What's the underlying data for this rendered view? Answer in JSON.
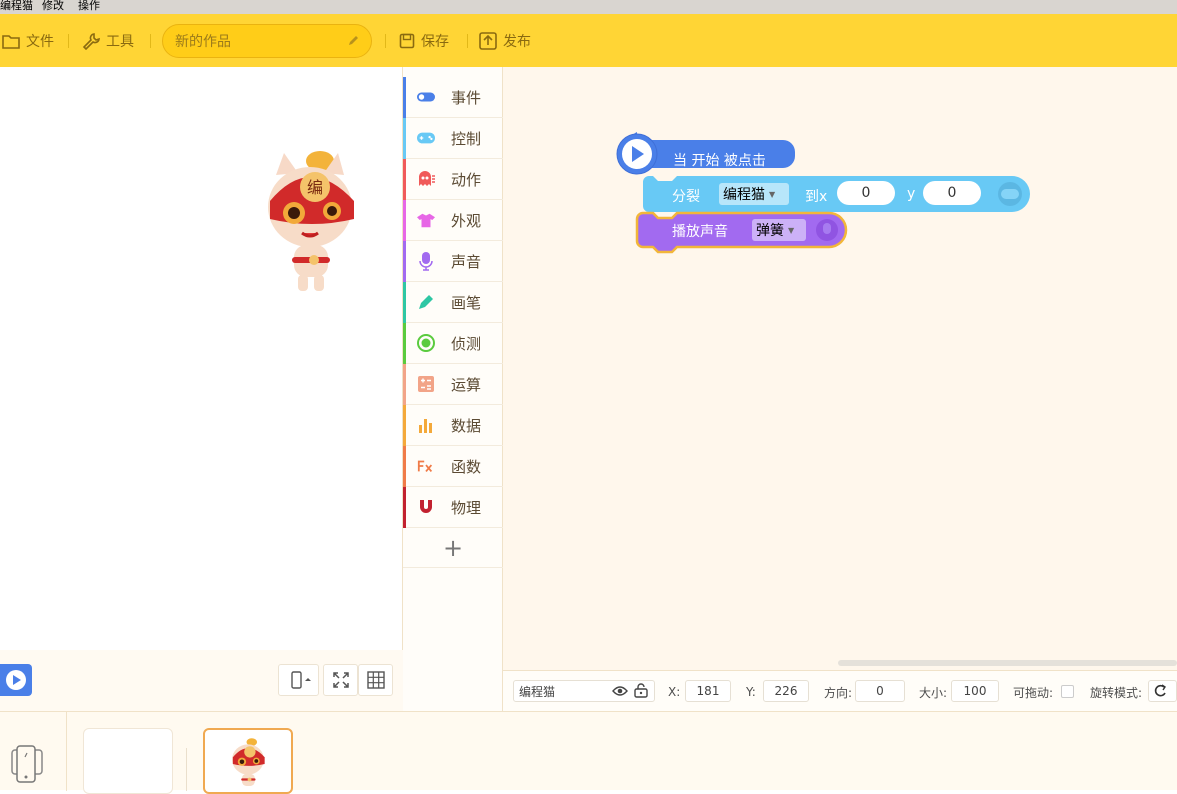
{
  "menubar": {
    "items": [
      "编程猫",
      "修改",
      "操作"
    ]
  },
  "toolbar": {
    "file_label": "文件",
    "tools_label": "工具",
    "title_placeholder": "新的作品",
    "save_label": "保存",
    "publish_label": "发布"
  },
  "palette": {
    "categories": [
      {
        "label": "事件",
        "color": "#4a7fe8"
      },
      {
        "label": "控制",
        "color": "#68c9f5"
      },
      {
        "label": "动作",
        "color": "#f05a5a"
      },
      {
        "label": "外观",
        "color": "#e767e6"
      },
      {
        "label": "声音",
        "color": "#a26af0"
      },
      {
        "label": "画笔",
        "color": "#2ec7a4"
      },
      {
        "label": "侦测",
        "color": "#5acb3e"
      },
      {
        "label": "运算",
        "color": "#f2a488"
      },
      {
        "label": "数据",
        "color": "#f4a93a"
      },
      {
        "label": "函数",
        "color": "#f07b48"
      },
      {
        "label": "物理",
        "color": "#c2212f"
      }
    ],
    "add_label": "+"
  },
  "blocks": {
    "hat_label": "当 开始 被点击",
    "split_label": "分裂",
    "split_target": "编程猫",
    "to_x_label": "到x",
    "x_value": "0",
    "y_label": "y",
    "y_value": "0",
    "play_sound_label": "播放声音",
    "sound_value": "弹簧"
  },
  "props": {
    "sprite_name": "编程猫",
    "x_label": "X:",
    "x_value": "181",
    "y_label": "Y:",
    "y_value": "226",
    "direction_label": "方向:",
    "direction_value": "0",
    "size_label": "大小:",
    "size_value": "100",
    "draggable_label": "可拖动:",
    "rotation_label": "旋转模式:"
  },
  "colors": {
    "toolbar": "#ffd535",
    "event_blue": "#4a7fe8",
    "control_cyan": "#68c9f5",
    "sound_purple": "#a26af0"
  }
}
